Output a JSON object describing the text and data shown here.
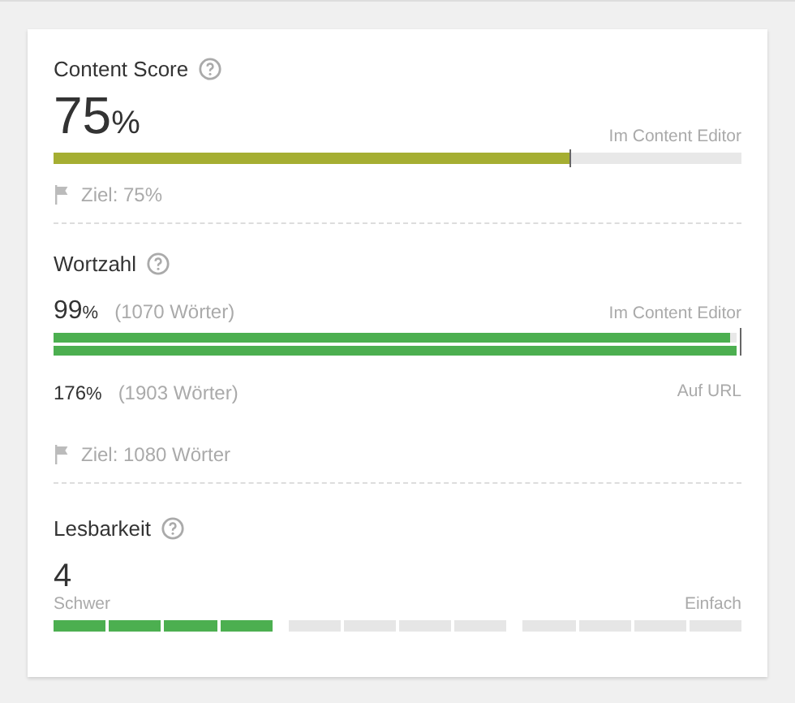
{
  "content_score": {
    "title": "Content Score",
    "value": "75",
    "unit": "%",
    "bar_label": "Im Content Editor",
    "bar": {
      "level": 0.75
    },
    "goal": "Ziel: 75%"
  },
  "word_count": {
    "title": "Wortzahl",
    "editor_value": "99",
    "editor_unit": "%",
    "editor_words": "(1070 Wörter)",
    "editor_label": "Im Content Editor",
    "editor_bar": {
      "level": 0.99
    },
    "url_value": "176",
    "url_unit": "%",
    "url_words": "(1903 Wörter)",
    "url_label": "Auf URL",
    "url_bar": {
      "level": 1
    },
    "goal": "Ziel: 1080 Wörter"
  },
  "readability": {
    "title": "Lesbarkeit",
    "value": "4",
    "left_label": "Schwer",
    "right_label": "Einfach",
    "scale": {
      "level": 0.3333
    }
  }
}
